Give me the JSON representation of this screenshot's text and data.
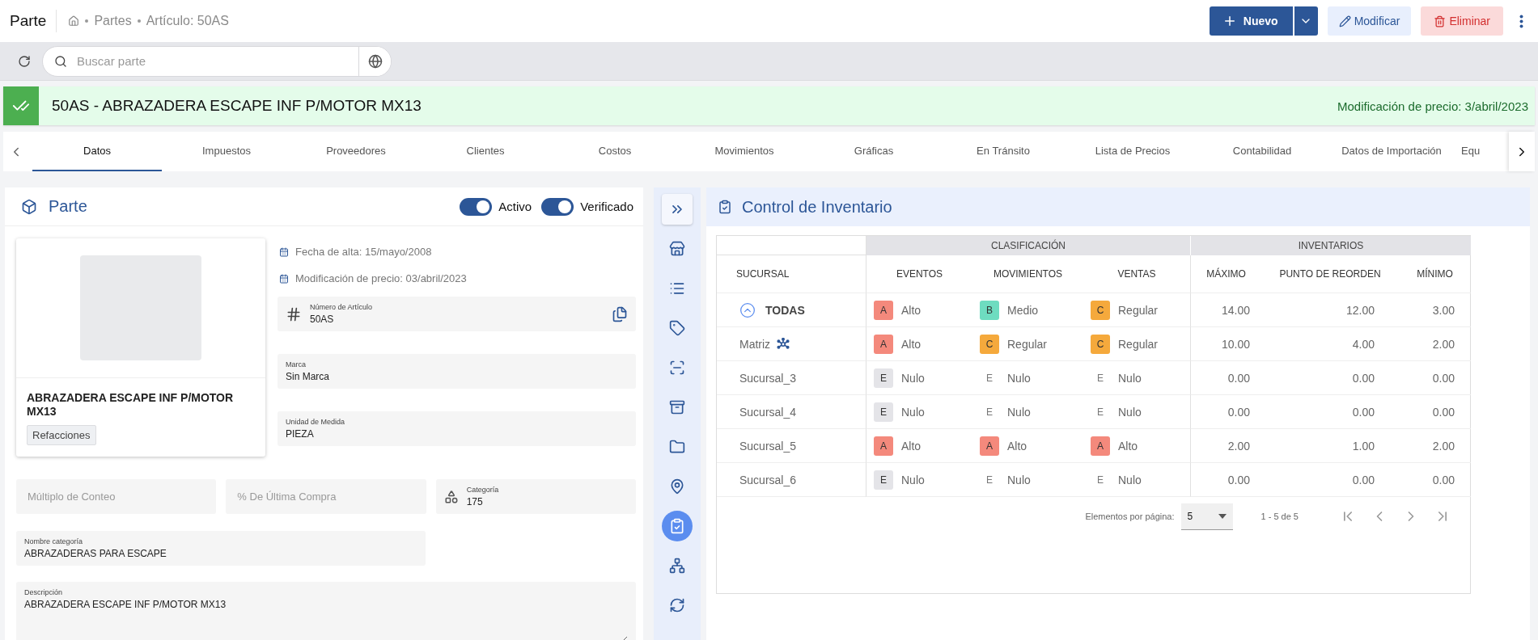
{
  "header": {
    "title": "Parte",
    "breadcrumb": [
      "Partes",
      "Artículo: 50AS"
    ],
    "new_button": "Nuevo",
    "edit_button": "Modificar",
    "delete_button": "Eliminar"
  },
  "search": {
    "placeholder": "Buscar parte"
  },
  "banner": {
    "title": "50AS - ABRAZADERA ESCAPE INF P/MOTOR MX13",
    "price_change": "Modificación de precio: 3/abril/2023"
  },
  "tabs": [
    {
      "label": "Datos",
      "selected": true
    },
    {
      "label": "Impuestos",
      "selected": false
    },
    {
      "label": "Proveedores",
      "selected": false
    },
    {
      "label": "Clientes",
      "selected": false
    },
    {
      "label": "Costos",
      "selected": false
    },
    {
      "label": "Movimientos",
      "selected": false
    },
    {
      "label": "Gráficas",
      "selected": false
    },
    {
      "label": "En Tránsito",
      "selected": false
    },
    {
      "label": "Lista de Precios",
      "selected": false
    },
    {
      "label": "Contabilidad",
      "selected": false
    },
    {
      "label": "Datos de Importación",
      "selected": false
    },
    {
      "label": "Equ",
      "selected": false
    }
  ],
  "part_panel": {
    "title": "Parte",
    "toggles": [
      {
        "label": "Activo",
        "on": true
      },
      {
        "label": "Verificado",
        "on": true
      }
    ],
    "product": {
      "name": "ABRAZADERA ESCAPE INF P/MOTOR MX13",
      "tag": "Refacciones"
    },
    "dates": [
      "Fecha de alta: 15/mayo/2008",
      "Modificación de precio: 03/abril/2023"
    ],
    "article": {
      "label": "Número de Artículo",
      "value": "50AS"
    },
    "brand": {
      "label": "Marca",
      "value": "Sin Marca"
    },
    "unit": {
      "label": "Unidad de Medida",
      "value": "PIEZA"
    },
    "count_multiple": {
      "placeholder": "Múltiplo de Conteo"
    },
    "last_purchase": {
      "placeholder": "% De Última Compra"
    },
    "category": {
      "label": "Categoría",
      "value": "175"
    },
    "category_name": {
      "label": "Nombre categoría",
      "value": "ABRAZADERAS PARA ESCAPE"
    },
    "description": {
      "label": "Descripción",
      "value": "ABRAZADERA ESCAPE INF P/MOTOR MX13"
    }
  },
  "rail": [
    {
      "kind": "expand",
      "selected": false
    },
    {
      "kind": "store",
      "selected": false
    },
    {
      "kind": "list",
      "selected": false
    },
    {
      "kind": "tag",
      "selected": false
    },
    {
      "kind": "scan",
      "selected": false
    },
    {
      "kind": "archive",
      "selected": false
    },
    {
      "kind": "folder",
      "selected": false
    },
    {
      "kind": "location",
      "selected": false
    },
    {
      "kind": "inventory",
      "selected": true
    },
    {
      "kind": "tree",
      "selected": false
    },
    {
      "kind": "sync",
      "selected": false
    }
  ],
  "inventory": {
    "title": "Control de Inventario",
    "groups": [
      "CLASIFICACIÓN",
      "INVENTARIOS"
    ],
    "columns": [
      "SUCURSAL",
      "EVENTOS",
      "MOVIMIENTOS",
      "VENTAS",
      "MÁXIMO",
      "PUNTO DE REORDEN",
      "MÍNIMO"
    ],
    "rows": [
      {
        "kind": "total",
        "name": "TODAS",
        "expanded": true,
        "classes": [
          {
            "letter": "A",
            "label": "Alto",
            "color": "#f4897c"
          },
          {
            "letter": "B",
            "label": "Medio",
            "color": "#6edcc0"
          },
          {
            "letter": "C",
            "label": "Regular",
            "color": "#f5a93c"
          }
        ],
        "values": [
          "14.00",
          "12.00",
          "3.00"
        ]
      },
      {
        "kind": "main",
        "name": "Matriz",
        "classes": [
          {
            "letter": "A",
            "label": "Alto",
            "color": "#f4897c"
          },
          {
            "letter": "C",
            "label": "Regular",
            "color": "#f5a93c"
          },
          {
            "letter": "C",
            "label": "Regular",
            "color": "#f5a93c"
          }
        ],
        "values": [
          "10.00",
          "4.00",
          "2.00"
        ]
      },
      {
        "kind": "branch",
        "name": "Sucursal_3",
        "classes": [
          {
            "letter": "E",
            "label": "Nulo",
            "color": "#e4e4e8"
          },
          {
            "letter": "E",
            "label": "Nulo"
          },
          {
            "letter": "E",
            "label": "Nulo"
          }
        ],
        "values": [
          "0.00",
          "0.00",
          "0.00"
        ]
      },
      {
        "kind": "branch",
        "name": "Sucursal_4",
        "classes": [
          {
            "letter": "E",
            "label": "Nulo",
            "color": "#e4e4e8"
          },
          {
            "letter": "E",
            "label": "Nulo"
          },
          {
            "letter": "E",
            "label": "Nulo"
          }
        ],
        "values": [
          "0.00",
          "0.00",
          "0.00"
        ]
      },
      {
        "kind": "branch",
        "name": "Sucursal_5",
        "classes": [
          {
            "letter": "A",
            "label": "Alto",
            "color": "#f4897c"
          },
          {
            "letter": "A",
            "label": "Alto",
            "color": "#f4897c"
          },
          {
            "letter": "A",
            "label": "Alto",
            "color": "#f4897c"
          }
        ],
        "values": [
          "2.00",
          "1.00",
          "2.00"
        ]
      },
      {
        "kind": "branch",
        "name": "Sucursal_6",
        "classes": [
          {
            "letter": "E",
            "label": "Nulo",
            "color": "#e4e4e8"
          },
          {
            "letter": "E",
            "label": "Nulo"
          },
          {
            "letter": "E",
            "label": "Nulo"
          }
        ],
        "values": [
          "0.00",
          "0.00",
          "0.00"
        ]
      }
    ],
    "pagination": {
      "label": "Elementos por página:",
      "page_size": "5",
      "range": "1 - 5 de 5"
    }
  }
}
